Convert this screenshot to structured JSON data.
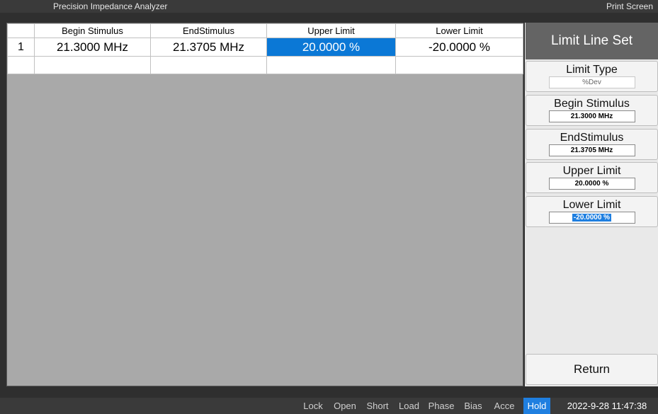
{
  "window": {
    "title": "Precision Impedance Analyzer",
    "print_screen": "Print Screen"
  },
  "table": {
    "headers": [
      "",
      "Begin Stimulus",
      "EndStimulus",
      "Upper Limit",
      "Lower Limit"
    ],
    "rows": [
      {
        "index": "1",
        "begin": "21.3000 MHz",
        "end": "21.3705 MHz",
        "upper": "20.0000 %",
        "lower": "-20.0000 %"
      }
    ]
  },
  "panel": {
    "title": "Limit Line Set",
    "limit_type": {
      "label": "Limit Type",
      "value": "%Dev"
    },
    "begin_stimulus": {
      "label": "Begin Stimulus",
      "value": "21.3000 MHz"
    },
    "end_stimulus": {
      "label": "EndStimulus",
      "value": "21.3705 MHz"
    },
    "upper_limit": {
      "label": "Upper Limit",
      "value": "20.0000 %"
    },
    "lower_limit": {
      "label": "Lower Limit",
      "value": "-20.0000 %"
    },
    "return": "Return"
  },
  "status": {
    "lock": "Lock",
    "open": "Open",
    "short": "Short",
    "load": "Load",
    "phase": "Phase",
    "bias": "Bias",
    "acce": "Acce",
    "hold": "Hold",
    "datetime": "2022-9-28 11:47:38"
  },
  "colors": {
    "selected": "#0b78d6",
    "hold": "#1f7fe0",
    "panel_title": "#646464"
  }
}
